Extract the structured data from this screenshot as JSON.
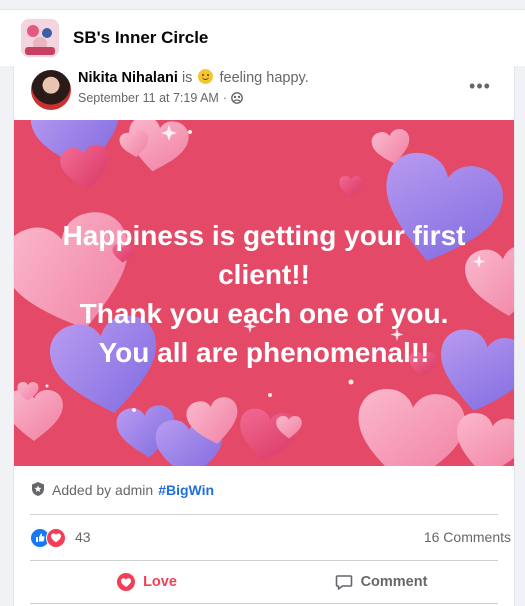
{
  "group": {
    "name": "SB's Inner Circle"
  },
  "post": {
    "author": "Nikita Nihalani",
    "is_text": "is",
    "feeling": "feeling happy.",
    "date": "September 11 at 7:19 AM",
    "separator": "·",
    "more": "•••",
    "image_text_lines": [
      "Happiness is getting your first",
      "client!!",
      "Thank you each one of you.",
      "You all are phenomenal!!"
    ]
  },
  "admin": {
    "added_by": "Added by admin",
    "hashtag": "#BigWin"
  },
  "stats": {
    "reactions": "43",
    "comments": "16 Comments"
  },
  "actions": {
    "love": "Love",
    "comment": "Comment"
  },
  "colors": {
    "love": "#f33e58",
    "like": "#1877f2",
    "hashtag": "#216fdb",
    "image_background": "#e44a67"
  },
  "icons": {
    "privacy": "group-privacy-icon",
    "admin": "admin-shield-icon",
    "like": "like-reaction-icon",
    "love": "love-reaction-icon",
    "comment": "comment-icon",
    "more": "more-options-icon"
  }
}
